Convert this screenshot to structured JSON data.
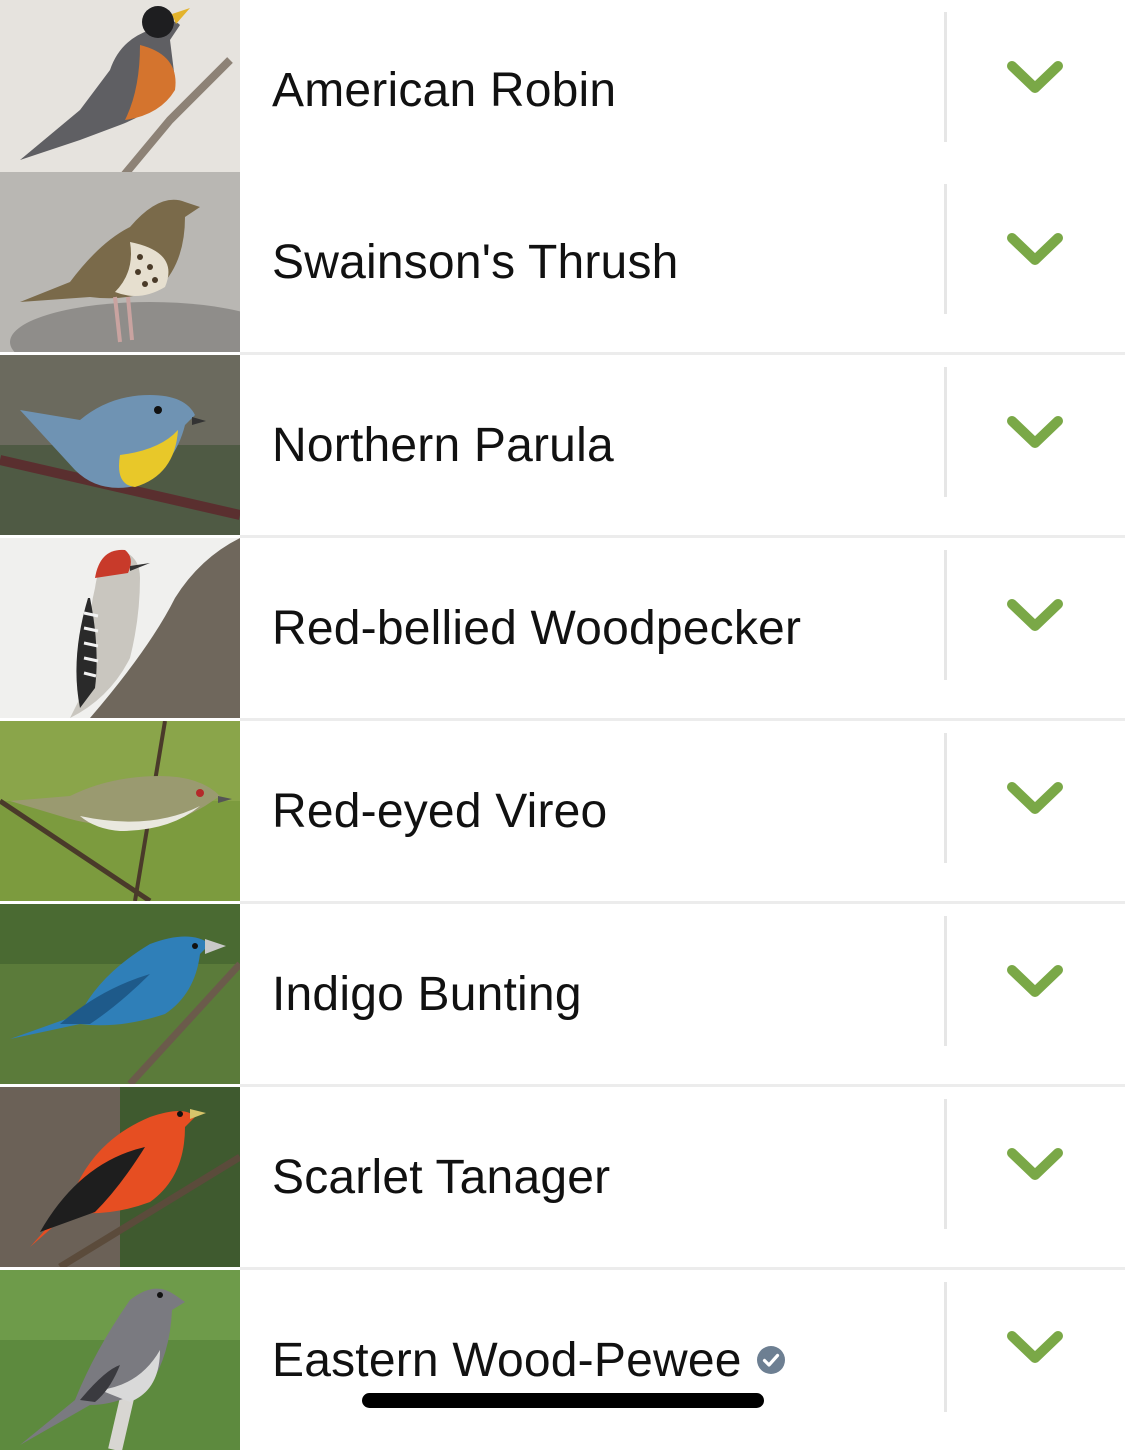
{
  "accent_color": "#7aa847",
  "birds": [
    {
      "name": "American Robin",
      "image": "american-robin-photo",
      "verified": false,
      "expand_icon": "chevron-down-icon"
    },
    {
      "name": "Swainson's Thrush",
      "image": "swainsons-thrush-photo",
      "verified": false,
      "expand_icon": "chevron-down-icon"
    },
    {
      "name": "Northern Parula",
      "image": "northern-parula-photo",
      "verified": false,
      "expand_icon": "chevron-down-icon"
    },
    {
      "name": "Red-bellied Woodpecker",
      "image": "red-bellied-woodpecker-photo",
      "verified": false,
      "expand_icon": "chevron-down-icon"
    },
    {
      "name": "Red-eyed Vireo",
      "image": "red-eyed-vireo-photo",
      "verified": false,
      "expand_icon": "chevron-down-icon"
    },
    {
      "name": "Indigo Bunting",
      "image": "indigo-bunting-photo",
      "verified": false,
      "expand_icon": "chevron-down-icon"
    },
    {
      "name": "Scarlet Tanager",
      "image": "scarlet-tanager-photo",
      "verified": false,
      "expand_icon": "chevron-down-icon"
    },
    {
      "name": "Eastern Wood-Pewee",
      "image": "eastern-wood-pewee-photo",
      "verified": true,
      "verified_icon": "verified-check-badge-icon",
      "expand_icon": "chevron-down-icon"
    }
  ]
}
